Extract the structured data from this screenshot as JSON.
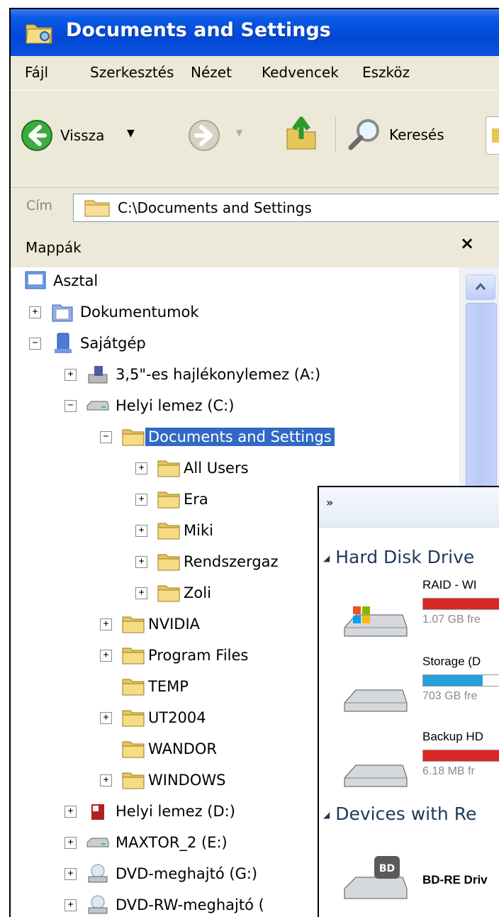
{
  "window": {
    "title": "Documents and Settings"
  },
  "menu": [
    "Fájl",
    "Szerkesztés",
    "Nézet",
    "Kedvencek",
    "Eszköz"
  ],
  "toolbar": {
    "back_label": "Vissza",
    "search_label": "Keresés"
  },
  "address": {
    "label": "Cím",
    "path": "C:\\Documents and Settings"
  },
  "folders_panel": {
    "title": "Mappák",
    "close_symbol": "×"
  },
  "tree": [
    {
      "label": "Asztal"
    },
    {
      "label": "Dokumentumok",
      "expander": "+"
    },
    {
      "label": "Sajátgép",
      "expander": "−"
    },
    {
      "label": "3,5\"-es hajlékonylemez (A:)",
      "expander": "+"
    },
    {
      "label": "Helyi lemez (C:)",
      "expander": "−"
    },
    {
      "label": "Documents and Settings",
      "expander": "−",
      "selected": true
    },
    {
      "label": "All Users",
      "expander": "+"
    },
    {
      "label": "Era",
      "expander": "+"
    },
    {
      "label": "Miki",
      "expander": "+"
    },
    {
      "label": "Rendszergaz",
      "expander": "+"
    },
    {
      "label": "Zoli",
      "expander": "+"
    },
    {
      "label": "NVIDIA",
      "expander": "+"
    },
    {
      "label": "Program Files",
      "expander": "+"
    },
    {
      "label": "TEMP"
    },
    {
      "label": "UT2004",
      "expander": "+"
    },
    {
      "label": "WANDOR"
    },
    {
      "label": "WINDOWS",
      "expander": "+"
    },
    {
      "label": "Helyi lemez (D:)",
      "expander": "+"
    },
    {
      "label": "MAXTOR_2 (E:)",
      "expander": "+"
    },
    {
      "label": "DVD-meghajtó (G:)",
      "expander": "+"
    },
    {
      "label": "DVD-RW-meghajtó (",
      "expander": "+"
    }
  ],
  "overlay": {
    "chevron": "»",
    "hdd_group": "Hard Disk Drive",
    "drives": [
      {
        "name": "RAID - WI",
        "free": "1.07 GB fre",
        "bar_color": "#DA2626",
        "used_fraction": 0.99
      },
      {
        "name": "Storage (D",
        "free": "703 GB fre",
        "bar_color": "#26A0DA",
        "used_fraction": 0.6
      },
      {
        "name": "Backup HD",
        "free": "6.18 MB fr",
        "bar_color": "#DA2626",
        "used_fraction": 0.99
      }
    ],
    "removable_group": "Devices with Re",
    "bd_drive": {
      "name": "BD-RE Driv",
      "badge": "BD"
    }
  }
}
